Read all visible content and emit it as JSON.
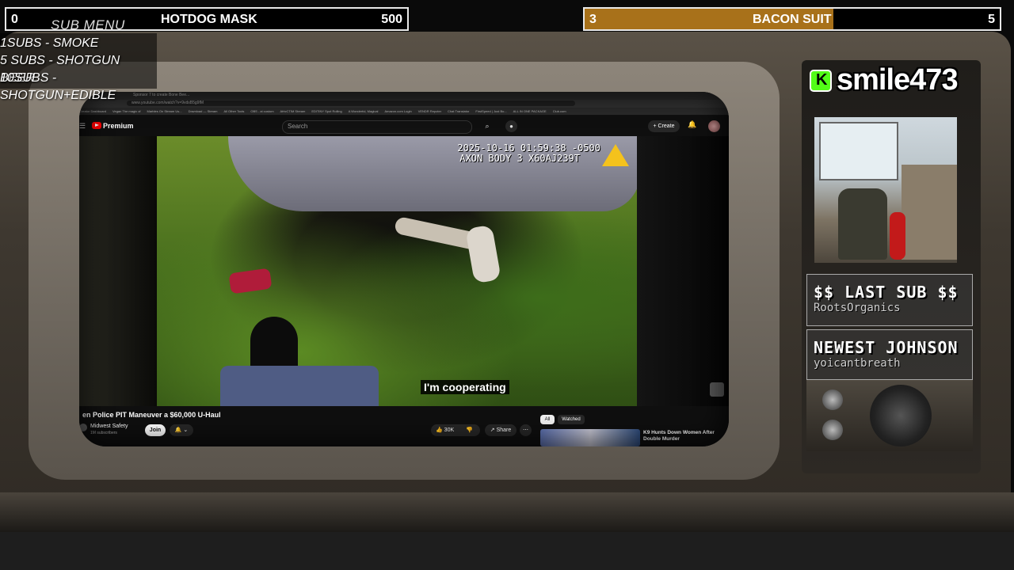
{
  "goals": {
    "left": {
      "current": "0",
      "sub_menu_label": "SUB MENU",
      "name": "HOTDOG MASK",
      "target": "500"
    },
    "right": {
      "current": "3",
      "name": "BACON SUIT",
      "target": "5",
      "progress_fraction": 0.6,
      "fill_color": "#a8711a"
    }
  },
  "sub_menu": {
    "items": [
      "1SUBS   - SMOKE",
      "5 SUBS  - SHOTGUN BEER",
      "10SUBS - SHOTGUN+EDIBLE"
    ]
  },
  "browser": {
    "tab_title": "Sponsor 7 to create Bone Bee...",
    "url": "www.youtube.com/watch?v=9vdsB5g9fM",
    "bookmarks": [
      "Creator Dashboard",
      "Vegan The magic of",
      "Marbles On Stream Us...",
      "Download — Stream",
      "All Other Tools",
      "OBS - ai custom",
      "AfricCTIM Stream",
      "EDITINY Spot Rolling",
      "A Wonderful, Magical",
      "Amazon.com Login",
      "VENDR Repoter",
      "Chat Translator",
      "FirstSpeed | Just Bo...",
      "ALL IN ONE PACKAGE",
      "Club.com"
    ]
  },
  "youtube": {
    "brand": "Premium",
    "search_placeholder": "Search",
    "create_label": "Create",
    "video": {
      "overlay_line1": "2025-10-16 01:59:38 -0500",
      "overlay_line2": "AXON BODY 3 X60AJ239T",
      "caption": "I'm cooperating"
    },
    "title": "en Police PIT Maneuver a $60,000 U-Haul",
    "channel": {
      "name": "Midwest Safety",
      "subs": "1M subscribers"
    },
    "join_label": "Join",
    "likes": "30K",
    "share_label": "Share",
    "chips": [
      "All",
      "Watched"
    ],
    "recommended": {
      "title": "K9 Hunts Down Women After Double Murder"
    }
  },
  "panel": {
    "platform": "kick",
    "username": "smile473",
    "last_sub": {
      "label": "$$ LAST SUB $$",
      "value": "RootsOrganics"
    },
    "newest": {
      "label": "NEWEST JOHNSON",
      "value": "yoicantbreath"
    }
  },
  "colors": {
    "accent_kick": "#53fc18",
    "axon_triangle": "#f4c21c"
  }
}
